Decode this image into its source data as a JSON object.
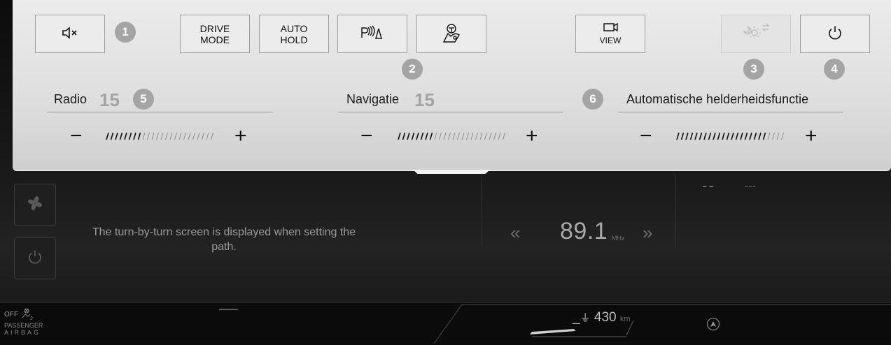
{
  "background": {
    "turn_message": "The turn-by-turn screen is displayed when setting the path.",
    "radio": {
      "prev": "«",
      "next": "»",
      "frequency": "89.1",
      "unit": "MHz"
    },
    "dashes_big": "--",
    "dashes_small": "---",
    "fan_icon": "fan-icon",
    "power_icon": "power-icon"
  },
  "bottom": {
    "airbag_off": "OFF",
    "airbag_label_1": "PASSENGER",
    "airbag_label_2": "AIRBAG",
    "range_value": "430",
    "range_unit": "km",
    "range_prefix": "_"
  },
  "quick_buttons": [
    {
      "id": "mute",
      "icon": "mute-icon",
      "label": ""
    },
    {
      "id": "drive-mode",
      "label_1": "DRIVE",
      "label_2": "MODE"
    },
    {
      "id": "auto-hold",
      "label_1": "AUTO",
      "label_2": "HOLD"
    },
    {
      "id": "park-sensor",
      "icon": "parking-sensor-icon"
    },
    {
      "id": "driver-assist",
      "icon": "driver-assist-icon"
    },
    {
      "id": "view",
      "icon": "camera-icon",
      "label": "VIEW"
    },
    {
      "id": "brightness",
      "icon": "brightness-auto-icon",
      "disabled": true
    },
    {
      "id": "power",
      "icon": "power-icon"
    }
  ],
  "badges": {
    "b1": "1",
    "b2": "2",
    "b3": "3",
    "b4": "4",
    "b5": "5",
    "b6": "6"
  },
  "sliders": [
    {
      "title": "Radio",
      "value": "15",
      "level_fraction": 0.33
    },
    {
      "title": "Navigatie",
      "value": "15",
      "level_fraction": 0.33
    },
    {
      "title": "Automatische helderheidsfunctie",
      "value": "",
      "level_fraction": 0.8
    }
  ],
  "slider_minus": "−",
  "slider_plus": "+"
}
